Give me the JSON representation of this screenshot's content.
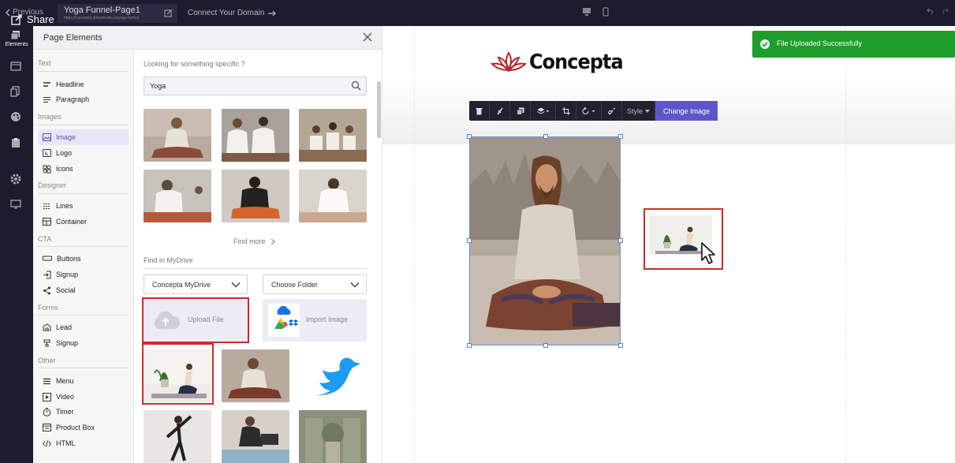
{
  "topbar": {
    "previous_label": "Previous",
    "share_label": "Share",
    "page_title": "Yoga Funnel-Page1",
    "page_url": "https://concepta.dotcomsite.co/yoga-funnel",
    "connect_domain_label": "Connect Your Domain"
  },
  "rail": {
    "elements_label": "Elements",
    "icons": [
      "layers-icon",
      "layout-icon",
      "pages-icon",
      "palette-icon",
      "clipboard-icon",
      "gear-icon",
      "monitor-icon"
    ]
  },
  "panel": {
    "title": "Page Elements",
    "sections": [
      {
        "label": "Text",
        "items": [
          {
            "label": "Headline",
            "icon": "headline-icon"
          },
          {
            "label": "Paragraph",
            "icon": "paragraph-icon"
          }
        ]
      },
      {
        "label": "Images",
        "items": [
          {
            "label": "Image",
            "icon": "image-icon"
          },
          {
            "label": "Logo",
            "icon": "logo-icon"
          },
          {
            "label": "Icons",
            "icon": "icons-icon"
          }
        ]
      },
      {
        "label": "Designer",
        "items": [
          {
            "label": "Lines",
            "icon": "lines-icon"
          },
          {
            "label": "Container",
            "icon": "container-icon"
          }
        ]
      },
      {
        "label": "CTA",
        "items": [
          {
            "label": "Buttons",
            "icon": "button-icon"
          },
          {
            "label": "Signup",
            "icon": "signup-icon"
          },
          {
            "label": "Social",
            "icon": "share-icon"
          }
        ]
      },
      {
        "label": "Forms",
        "items": [
          {
            "label": "Lead",
            "icon": "lead-icon"
          },
          {
            "label": "Signup",
            "icon": "form-signup-icon"
          }
        ]
      },
      {
        "label": "Other",
        "items": [
          {
            "label": "Menu",
            "icon": "menu-icon"
          },
          {
            "label": "Video",
            "icon": "video-icon"
          },
          {
            "label": "Timer",
            "icon": "timer-icon"
          },
          {
            "label": "Product Box",
            "icon": "product-box-icon"
          },
          {
            "label": "HTML",
            "icon": "code-icon"
          }
        ]
      }
    ],
    "search_hint": "Looking for something specific ?",
    "search_value": "Yoga",
    "find_more": "Find more",
    "mydrive_label": "Find in MyDrive",
    "drive_select": "Concepta MyDrive",
    "folder_select": "Choose Folder",
    "upload_label": "Upload File",
    "import_label": "Import Image"
  },
  "canvas": {
    "brand_name": "Concepta",
    "style_label": "Style",
    "change_image_label": "Change Image",
    "toast_message": "File Uploaded Successfully"
  },
  "colors": {
    "dark": "#1e1b2e",
    "accent": "#5b57c8",
    "success": "#1f9d2a",
    "highlight": "#d12a2a",
    "brand_red": "#b5262a"
  }
}
